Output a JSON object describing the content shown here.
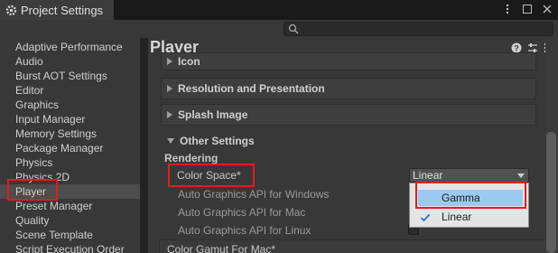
{
  "window": {
    "title": "Project Settings",
    "icon": "gear-icon"
  },
  "sidebar": {
    "items": [
      {
        "label": "Adaptive Performance"
      },
      {
        "label": "Audio"
      },
      {
        "label": "Burst AOT Settings"
      },
      {
        "label": "Editor"
      },
      {
        "label": "Graphics"
      },
      {
        "label": "Input Manager"
      },
      {
        "label": "Memory Settings"
      },
      {
        "label": "Package Manager"
      },
      {
        "label": "Physics"
      },
      {
        "label": "Physics 2D"
      },
      {
        "label": "Player",
        "selected": true
      },
      {
        "label": "Preset Manager"
      },
      {
        "label": "Quality"
      },
      {
        "label": "Scene Template"
      },
      {
        "label": "Script Execution Order"
      }
    ]
  },
  "main": {
    "title": "Player",
    "sections": {
      "icon": "Icon",
      "resolution": "Resolution and Presentation",
      "splash": "Splash Image",
      "other": "Other Settings"
    },
    "rendering_heading": "Rendering",
    "color_space_label": "Color Space*",
    "color_space_value": "Linear",
    "auto_windows": "Auto Graphics API  for Windows",
    "auto_mac": "Auto Graphics API  for Mac",
    "auto_linux": "Auto Graphics API  for Linux",
    "color_gamut_mac": "Color Gamut For Mac*",
    "dropdown_options": [
      {
        "label": "Gamma",
        "hover": true
      },
      {
        "label": "Linear",
        "checked": true
      }
    ]
  },
  "colors": {
    "highlight": "#e31d1d",
    "hover": "#9cc9f2",
    "selected_item": "#4d4d4d"
  }
}
